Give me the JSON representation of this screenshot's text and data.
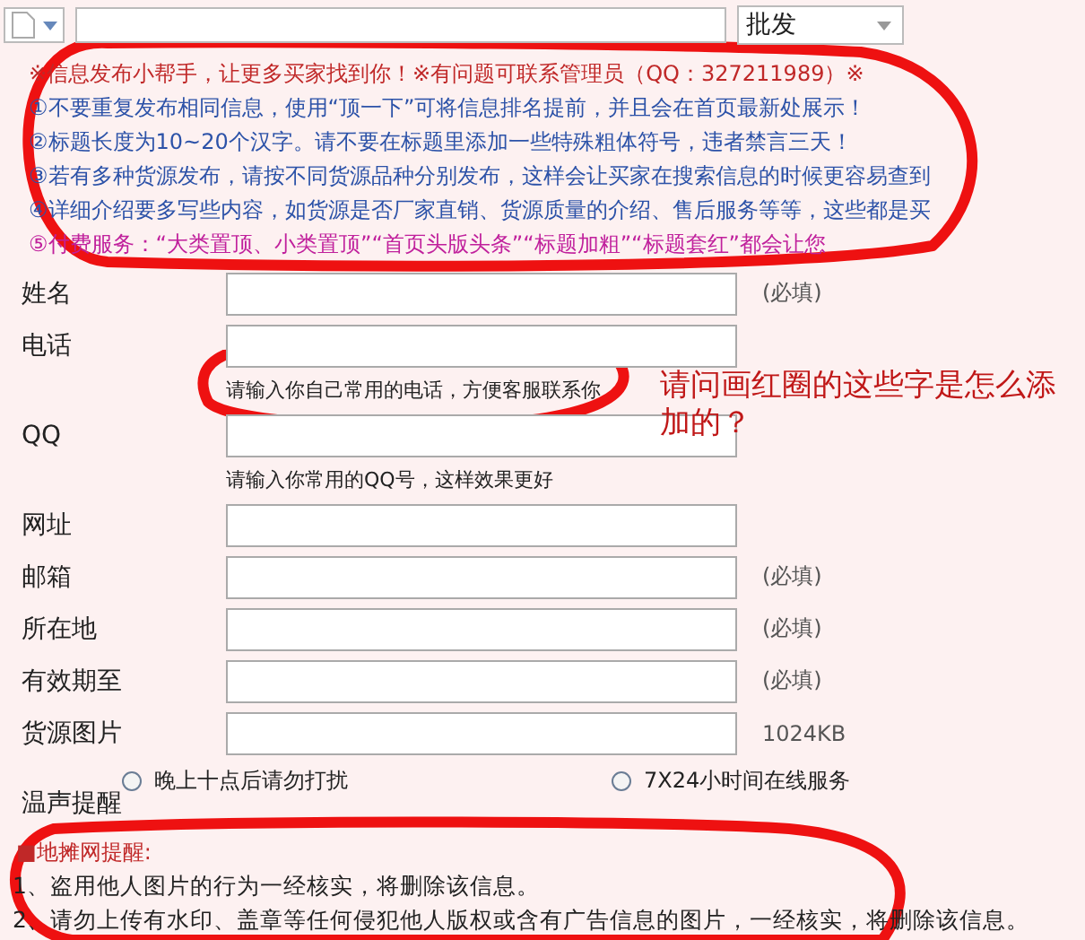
{
  "toolbar": {
    "category": "批发"
  },
  "notice_lines": [
    {
      "kind": "header",
      "text": "※信息发布小帮手，让更多买家找到你！※有问题可联系管理员（QQ：327211989）※"
    },
    {
      "kind": "rule",
      "text": "①不要重复发布相同信息，使用“顶一下”可将信息排名提前，并且会在首页最新处展示！"
    },
    {
      "kind": "rule",
      "text": "②标题长度为10~20个汉字。请不要在标题里添加一些特殊粗体符号，违者禁言三天！"
    },
    {
      "kind": "rule",
      "text": "③若有多种货源发布，请按不同货源品种分别发布，这样会让买家在搜索信息的时候更容易查到"
    },
    {
      "kind": "rule",
      "text": "④详细介绍要多写些内容，如货源是否厂家直销、货源质量的介绍、售后服务等等，这些都是买"
    },
    {
      "kind": "paid",
      "text": "⑤付费服务：“大类置顶、小类置顶”“首页头版头条”“标题加粗”“标题套红”都会让您"
    }
  ],
  "fields": [
    {
      "label": "姓名",
      "note": "(必填)"
    },
    {
      "label": "电话",
      "hint": "请输入你自己常用的电话，方便客服联系你"
    },
    {
      "label": "QQ",
      "hint": "请输入你常用的QQ号，这样效果更好"
    },
    {
      "label": "网址"
    },
    {
      "label": "邮箱",
      "note": "(必填)"
    },
    {
      "label": "所在地",
      "note": "(必填)"
    },
    {
      "label": "有效期至",
      "note": "(必填)"
    },
    {
      "label": "货源图片",
      "note": "1024KB"
    }
  ],
  "reminder": {
    "label": "温声提醒",
    "options": [
      {
        "label": "晚上十点后请勿打扰",
        "selected": false
      },
      {
        "label": "7X24小时间在线服务",
        "selected": false
      }
    ]
  },
  "footer": {
    "title": "■地摊网提醒:",
    "lines": [
      "1、盗用他人图片的行为一经核实，将删除该信息。",
      "2、请勿上传有水印、盖章等任何侵犯他人版权或含有广告信息的图片，一经核实，将删除该信息。"
    ]
  },
  "annotation": "请问画红圈的这些字是怎么添加的？"
}
